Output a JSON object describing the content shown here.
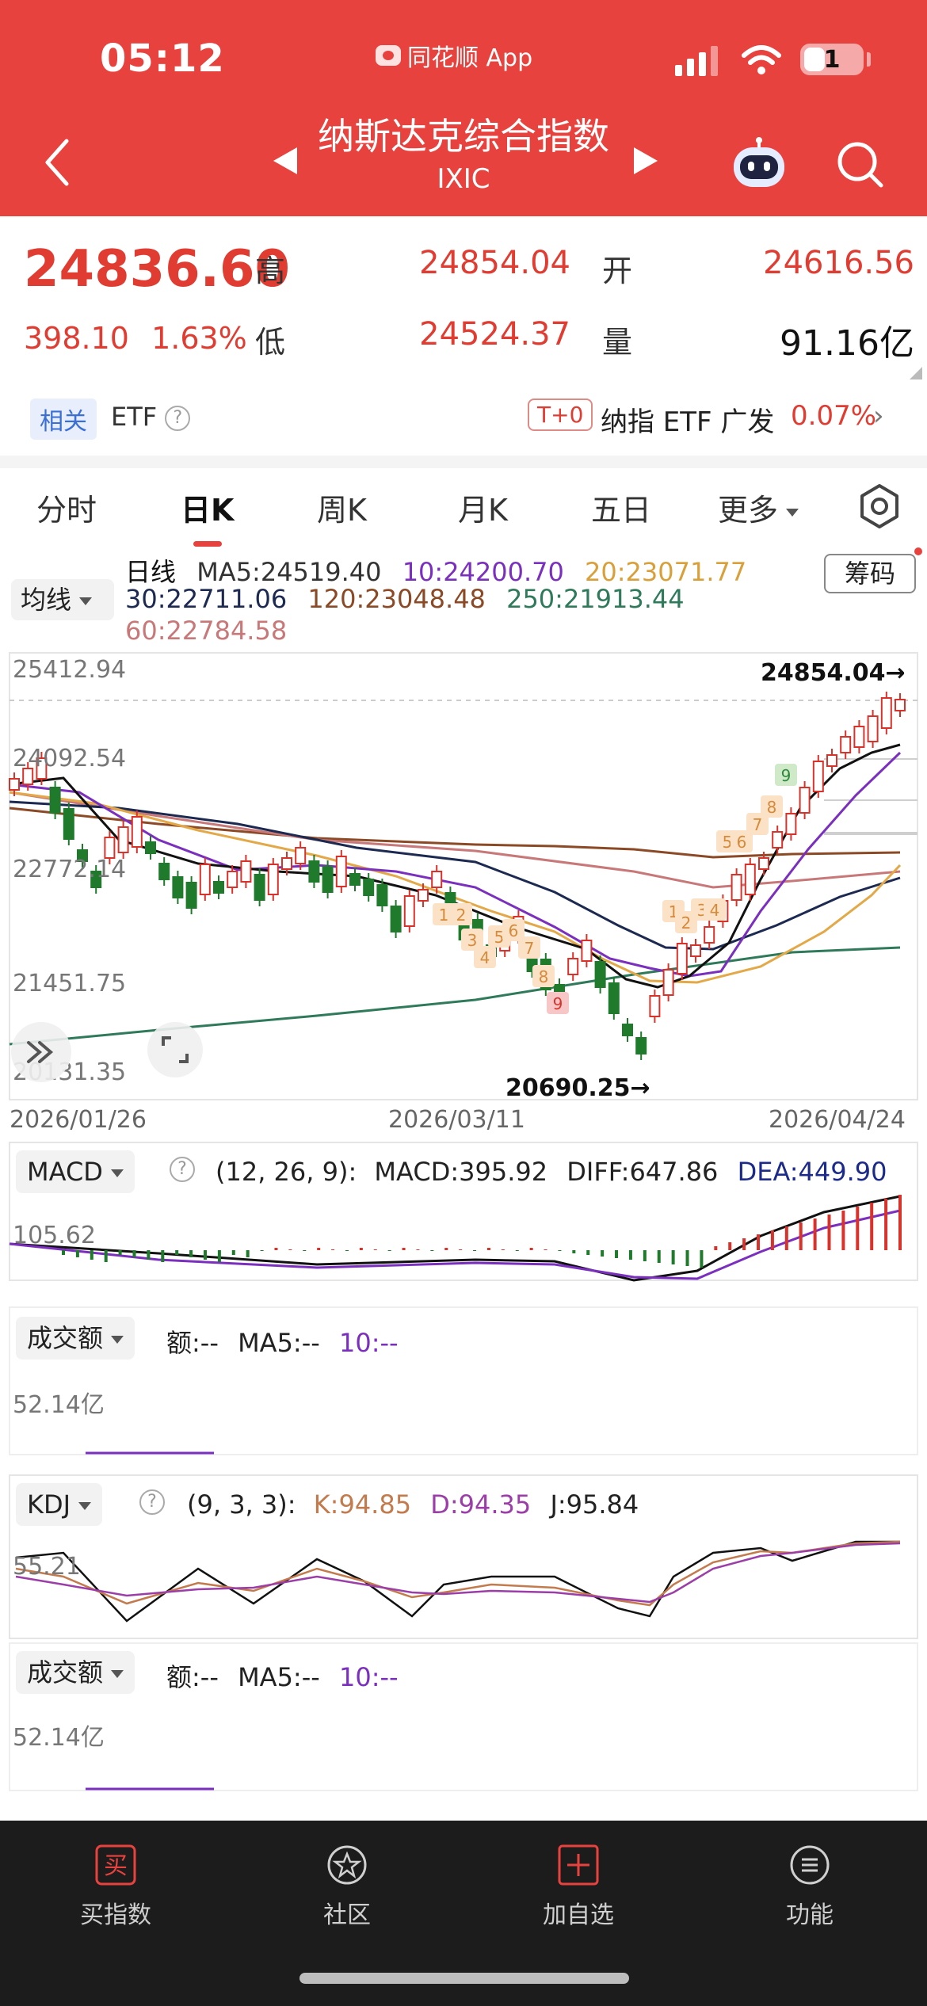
{
  "status": {
    "time": "05:12",
    "source": "同花顺 App",
    "battery": "1"
  },
  "header": {
    "title": "纳斯达克综合指数",
    "code": "IXIC"
  },
  "quote": {
    "price": "24836.60",
    "change": "398.10",
    "change_pct": "1.63%",
    "high_label": "高",
    "high": "24854.04",
    "low_label": "低",
    "low": "24524.37",
    "open_label": "开",
    "open": "24616.56",
    "vol_label": "量",
    "volume": "91.16亿"
  },
  "related": {
    "tag": "相关",
    "etf": "ETF",
    "t0": "T+0",
    "name": "纳指 ETF 广发",
    "pct": "0.07%"
  },
  "tabs": [
    "分时",
    "日K",
    "周K",
    "月K",
    "五日",
    "更多"
  ],
  "ma": {
    "button": "均线",
    "period": "日线",
    "ma5": "MA5:24519.40",
    "ma10": "10:24200.70",
    "ma20": "20:23071.77",
    "ma30": "30:22711.06",
    "ma120": "120:23048.48",
    "ma250": "250:21913.44",
    "ma60": "60:22784.58",
    "chip": "筹码"
  },
  "colors": {
    "up": "#d9322b",
    "down": "#1f7a2c",
    "ma5": "#111111",
    "ma10": "#7b2fbf",
    "ma20": "#e3a847",
    "ma30": "#1c2a52",
    "ma60": "#c87878",
    "ma120": "#8b4a25",
    "ma250": "#2f7a5a"
  },
  "price_axis": [
    "25412.94",
    "24092.54",
    "22772.14",
    "21451.75",
    "20131.35"
  ],
  "dates": [
    "2026/01/26",
    "2026/03/11",
    "2026/04/24"
  ],
  "chart_labels": {
    "high_mark": "24854.04→",
    "low_mark": "20690.25→"
  },
  "countdown_labels": [
    "1",
    "2",
    "3",
    "4",
    "5",
    "6",
    "7",
    "8",
    "9",
    "1",
    "2",
    "3",
    "4",
    "5",
    "6",
    "7",
    "8",
    "9"
  ],
  "macd": {
    "name": "MACD",
    "params": "(12, 26, 9):",
    "macd": "MACD:395.92",
    "diff": "DIFF:647.86",
    "dea": "DEA:449.90",
    "axis": "105.62"
  },
  "turnover1": {
    "name": "成交额",
    "amt": "额:--",
    "ma5": "MA5:--",
    "ma10": "10:--",
    "axis": "52.14亿"
  },
  "kdj": {
    "name": "KDJ",
    "params": "(9, 3, 3):",
    "k": "K:94.85",
    "d": "D:94.35",
    "j": "J:95.84",
    "axis": "55.21"
  },
  "turnover2": {
    "name": "成交额",
    "amt": "额:--",
    "ma5": "MA5:--",
    "ma10": "10:--",
    "axis": "52.14亿"
  },
  "bottom_nav": [
    {
      "label": "买指数",
      "icon": "买"
    },
    {
      "label": "社区"
    },
    {
      "label": "加自选"
    },
    {
      "label": "功能"
    }
  ]
}
